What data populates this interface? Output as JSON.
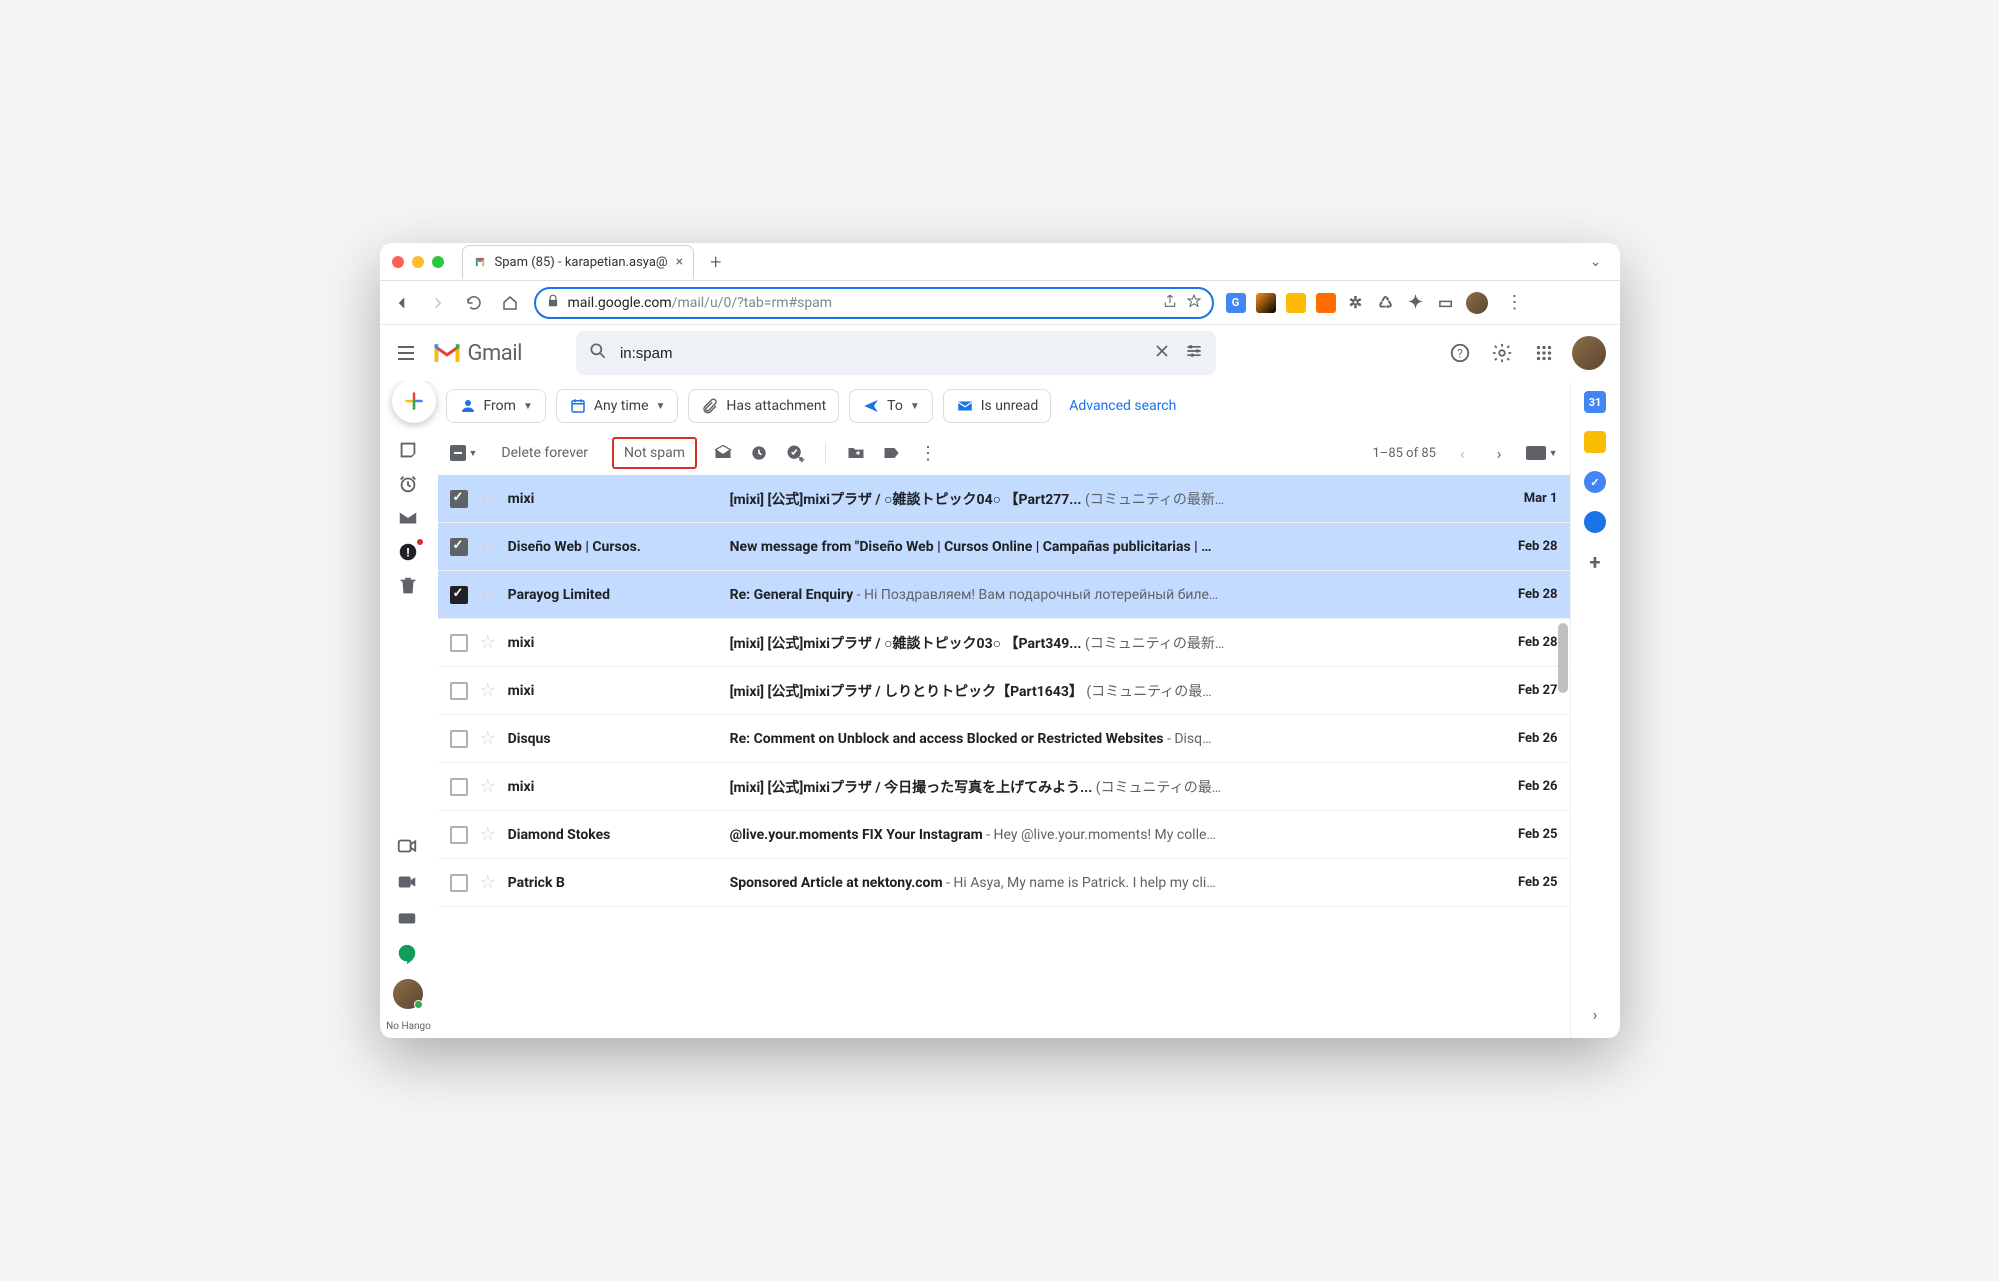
{
  "browser": {
    "tab_title": "Spam (85) - karapetian.asya@",
    "url_host": "mail.google.com",
    "url_path": "/mail/u/0/?tab=rm#spam"
  },
  "gmail": {
    "product": "Gmail",
    "search_value": "in:spam",
    "filters": {
      "from": "From",
      "any_time": "Any time",
      "has_attachment": "Has attachment",
      "to": "To",
      "is_unread": "Is unread",
      "advanced": "Advanced search"
    },
    "toolbar": {
      "delete_forever": "Delete forever",
      "not_spam": "Not spam",
      "pager": "1–85 of 85"
    },
    "mails": [
      {
        "sender": "mixi",
        "subject": "[mixi] [公式]mixiプラザ / ○雑談トピック04○ 【Part277...",
        "snippet": " (コミュニティの最新…",
        "date": "Mar 1",
        "selected": true
      },
      {
        "sender": "Diseño Web | Cursos.",
        "subject": "New message from \"Diseño Web | Cursos Online | Campañas publicitarias | …",
        "snippet": "",
        "date": "Feb 28",
        "selected": true
      },
      {
        "sender": "Parayog Limited",
        "subject": "Re: General Enquiry",
        "snippet": " - Hi Поздравляем! Вам подарочный лотерейный биле…",
        "date": "Feb 28",
        "selected": true,
        "dark": true
      },
      {
        "sender": "mixi",
        "subject": "[mixi] [公式]mixiプラザ / ○雑談トピック03○ 【Part349...",
        "snippet": " (コミュニティの最新…",
        "date": "Feb 28",
        "selected": false
      },
      {
        "sender": "mixi",
        "subject": "[mixi] [公式]mixiプラザ / しりとりトピック【Part1643】",
        "snippet": " (コミュニティの最…",
        "date": "Feb 27",
        "selected": false
      },
      {
        "sender": "Disqus",
        "subject": "Re: Comment on Unblock and access Blocked or Restricted Websites",
        "snippet": " - Disq…",
        "date": "Feb 26",
        "selected": false
      },
      {
        "sender": "mixi",
        "subject": "[mixi] [公式]mixiプラザ / 今日撮った写真を上げてみよう...",
        "snippet": " (コミュニティの最…",
        "date": "Feb 26",
        "selected": false
      },
      {
        "sender": "Diamond Stokes",
        "subject": "@live.your.moments FIX Your Instagram",
        "snippet": " - Hey @live.your.moments! My colle…",
        "date": "Feb 25",
        "selected": false
      },
      {
        "sender": "Patrick B",
        "subject": "Sponsored Article at nektony.com",
        "snippet": " - Hi Asya, My name is Patrick. I help my cli…",
        "date": "Feb 25",
        "selected": false
      }
    ],
    "hangouts_label": "No\nHango"
  }
}
